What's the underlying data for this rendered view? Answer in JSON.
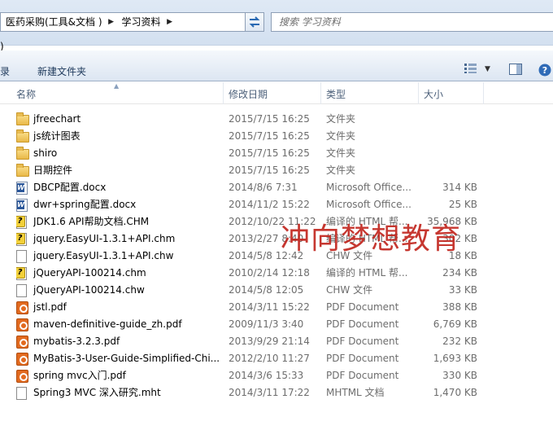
{
  "address": {
    "crumbs": [
      "医药采购(工具&文档 )",
      "学习资料"
    ],
    "search_placeholder": "搜索 学习资料"
  },
  "misc": {
    "paren_fragment": ")"
  },
  "toolbar": {
    "left_fragment": "录",
    "new_folder": "新建文件夹"
  },
  "columns": {
    "name": "名称",
    "date": "修改日期",
    "type": "类型",
    "size": "大小"
  },
  "files": [
    {
      "icon": "folder-icon",
      "name": "jfreechart",
      "date": "2015/7/15 16:25",
      "type": "文件夹",
      "size": ""
    },
    {
      "icon": "folder-icon",
      "name": "js统计图表",
      "date": "2015/7/15 16:25",
      "type": "文件夹",
      "size": ""
    },
    {
      "icon": "folder-icon",
      "name": "shiro",
      "date": "2015/7/15 16:25",
      "type": "文件夹",
      "size": ""
    },
    {
      "icon": "folder-icon",
      "name": "日期控件",
      "date": "2015/7/15 16:25",
      "type": "文件夹",
      "size": ""
    },
    {
      "icon": "word-doc-icon",
      "name": "DBCP配置.docx",
      "date": "2014/8/6 7:31",
      "type": "Microsoft Office...",
      "size": "314 KB"
    },
    {
      "icon": "word-doc-icon",
      "name": "dwr+spring配置.docx",
      "date": "2014/11/2 15:22",
      "type": "Microsoft Office...",
      "size": "25 KB"
    },
    {
      "icon": "chm-help-icon",
      "name": "JDK1.6 API帮助文档.CHM",
      "date": "2012/10/22 11:22",
      "type": "编译的 HTML 帮...",
      "size": "35,968 KB"
    },
    {
      "icon": "chm-help-icon",
      "name": "jquery.EasyUI-1.3.1+API.chm",
      "date": "2013/2/27 8:40",
      "type": "编译的 HTML 帮...",
      "size": "302 KB"
    },
    {
      "icon": "blank-file-icon",
      "name": "jquery.EasyUI-1.3.1+API.chw",
      "date": "2014/5/8 12:42",
      "type": "CHW 文件",
      "size": "18 KB"
    },
    {
      "icon": "chm-help-icon",
      "name": "jQueryAPI-100214.chm",
      "date": "2010/2/14 12:18",
      "type": "编译的 HTML 帮...",
      "size": "234 KB"
    },
    {
      "icon": "blank-file-icon",
      "name": "jQueryAPI-100214.chw",
      "date": "2014/5/8 12:05",
      "type": "CHW 文件",
      "size": "33 KB"
    },
    {
      "icon": "pdf-icon",
      "name": "jstl.pdf",
      "date": "2014/3/11 15:22",
      "type": "PDF Document",
      "size": "388 KB"
    },
    {
      "icon": "pdf-icon",
      "name": "maven-definitive-guide_zh.pdf",
      "date": "2009/11/3 3:40",
      "type": "PDF Document",
      "size": "6,769 KB"
    },
    {
      "icon": "pdf-icon",
      "name": "mybatis-3.2.3.pdf",
      "date": "2013/9/29 21:14",
      "type": "PDF Document",
      "size": "232 KB"
    },
    {
      "icon": "pdf-icon",
      "name": "MyBatis-3-User-Guide-Simplified-Chi...",
      "date": "2012/2/10 11:27",
      "type": "PDF Document",
      "size": "1,693 KB"
    },
    {
      "icon": "pdf-icon",
      "name": "spring mvc入门.pdf",
      "date": "2014/3/6 15:33",
      "type": "PDF Document",
      "size": "330 KB"
    },
    {
      "icon": "mht-file-icon",
      "name": "Spring3 MVC 深入研究.mht",
      "date": "2014/3/11 17:22",
      "type": "MHTML 文档",
      "size": "1,470 KB"
    }
  ],
  "watermark": "冲向梦想教育"
}
